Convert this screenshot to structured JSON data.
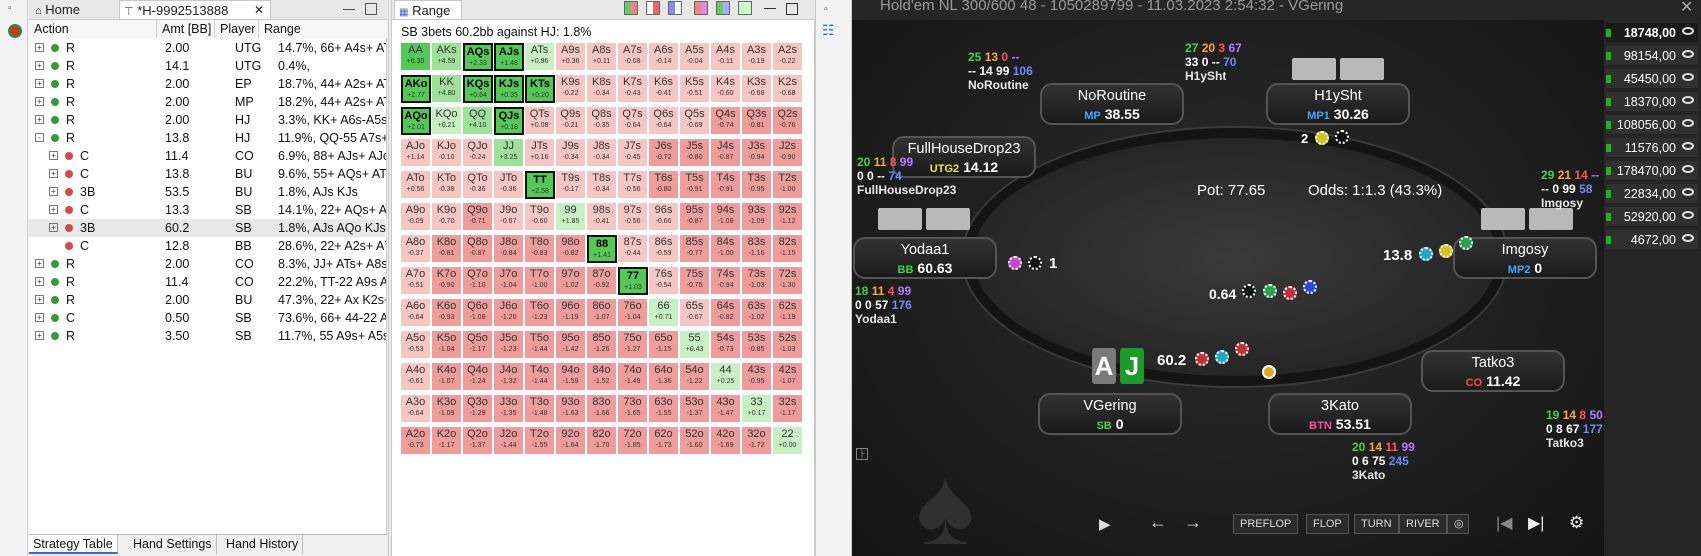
{
  "tabs": {
    "home": "Home",
    "hand": "*H-9992513888",
    "range": "Range"
  },
  "strategy": {
    "headers": [
      "Action",
      "Amt [BB]",
      "Player",
      "Range"
    ],
    "rows": [
      {
        "indent": 0,
        "exp": "+",
        "dot": "#3a9a3a",
        "action": "R",
        "amt": "2.00",
        "player": "UTG",
        "range": "14.7%, 66+ A4s+ ATo+"
      },
      {
        "indent": 0,
        "exp": "+",
        "dot": "#3a9a3a",
        "action": "R",
        "amt": "14.1",
        "player": "UTG",
        "range": "0.4%,"
      },
      {
        "indent": 0,
        "exp": "+",
        "dot": "#3a9a3a",
        "action": "R",
        "amt": "2.00",
        "player": "EP",
        "range": "18.7%, 44+ A2s+ ATo+"
      },
      {
        "indent": 0,
        "exp": "+",
        "dot": "#3a9a3a",
        "action": "R",
        "amt": "2.00",
        "player": "MP",
        "range": "18.2%, 44+ A2s+ ATo+"
      },
      {
        "indent": 0,
        "exp": "+",
        "dot": "#3a9a3a",
        "action": "R",
        "amt": "2.00",
        "player": "HJ",
        "range": "3.3%, KK+ A6s-A5s QT"
      },
      {
        "indent": 0,
        "exp": "-",
        "dot": "#3a9a3a",
        "action": "R",
        "amt": "13.8",
        "player": "HJ",
        "range": "11.9%, QQ-55 A7s+ A5"
      },
      {
        "indent": 1,
        "exp": "+",
        "dot": "#d24a4a",
        "action": "C",
        "amt": "11.4",
        "player": "CO",
        "range": "6.9%, 88+ AJs+ AJo+"
      },
      {
        "indent": 1,
        "exp": "+",
        "dot": "#d24a4a",
        "action": "C",
        "amt": "13.8",
        "player": "BU",
        "range": "9.6%, 55+ AQs+ ATs-A"
      },
      {
        "indent": 1,
        "exp": "+",
        "dot": "#d24a4a",
        "action": "3B",
        "amt": "53.5",
        "player": "BU",
        "range": "1.8%, AJs KJs"
      },
      {
        "indent": 1,
        "exp": "+",
        "dot": "#d24a4a",
        "action": "C",
        "amt": "13.3",
        "player": "SB",
        "range": "14.1%, 22+ AQs+ ATs-"
      },
      {
        "indent": 1,
        "exp": "+",
        "dot": "#d24a4a",
        "action": "3B",
        "amt": "60.2",
        "player": "SB",
        "range": "1.8%, AJs AQo KJs-KT"
      },
      {
        "indent": 1,
        "exp": "",
        "dot": "#d24a4a",
        "action": "C",
        "amt": "12.8",
        "player": "BB",
        "range": "28.6%, 22+ A2s+ A7o+"
      },
      {
        "indent": 0,
        "exp": "+",
        "dot": "#3a9a3a",
        "action": "R",
        "amt": "2.00",
        "player": "CO",
        "range": "8.3%, JJ+ ATs+ A8s A4"
      },
      {
        "indent": 0,
        "exp": "+",
        "dot": "#3a9a3a",
        "action": "R",
        "amt": "11.4",
        "player": "CO",
        "range": "22.2%, TT-22 A9s A7s-"
      },
      {
        "indent": 0,
        "exp": "+",
        "dot": "#3a9a3a",
        "action": "R",
        "amt": "2.00",
        "player": "BU",
        "range": "47.3%, 22+ Ax K2s+ K"
      },
      {
        "indent": 0,
        "exp": "+",
        "dot": "#3a9a3a",
        "action": "C",
        "amt": "0.50",
        "player": "SB",
        "range": "73.6%, 66+ 44-22 A8s-"
      },
      {
        "indent": 0,
        "exp": "+",
        "dot": "#3a9a3a",
        "action": "R",
        "amt": "3.50",
        "player": "SB",
        "range": "11.7%, 55 A9s+ A5s KT"
      }
    ],
    "bottom_tabs": [
      "Strategy Table",
      "Hand Settings",
      "Hand History"
    ]
  },
  "range": {
    "title": "SB 3bets 60.2bb against HJ: 1.8%",
    "grid": [
      [
        [
          "AA",
          "+6.30",
          "g"
        ],
        [
          "AKs",
          "+4.59",
          "lg"
        ],
        [
          "AQs",
          "+2.33",
          "gb"
        ],
        [
          "AJs",
          "+1.48",
          "gb"
        ],
        [
          "ATs",
          "+0.96",
          "lg"
        ],
        [
          "A9s",
          "+0.36",
          "lr"
        ],
        [
          "A8s",
          "+0.11",
          "lr"
        ],
        [
          "A7s",
          "-0.08",
          "lr"
        ],
        [
          "A6s",
          "-0.14",
          "lr"
        ],
        [
          "A5s",
          "-0.04",
          "lr"
        ],
        [
          "A4s",
          "-0.11",
          "lr"
        ],
        [
          "A3s",
          "-0.19",
          "lr"
        ],
        [
          "A2s",
          "-0.22",
          "lr"
        ]
      ],
      [
        [
          "AKo",
          "+2.77",
          "gb"
        ],
        [
          "KK",
          "+4.80",
          "lg"
        ],
        [
          "KQs",
          "+0.64",
          "gb"
        ],
        [
          "KJs",
          "+0.35",
          "gb"
        ],
        [
          "KTs",
          "+0.20",
          "gb"
        ],
        [
          "K9s",
          "-0.22",
          "lr"
        ],
        [
          "K8s",
          "-0.34",
          "lr"
        ],
        [
          "K7s",
          "-0.43",
          "lr"
        ],
        [
          "K6s",
          "-0.41",
          "lr"
        ],
        [
          "K5s",
          "-0.51",
          "lr"
        ],
        [
          "K4s",
          "-0.60",
          "lr"
        ],
        [
          "K3s",
          "-0.68",
          "lr"
        ],
        [
          "K2s",
          "-0.68",
          "lr"
        ]
      ],
      [
        [
          "AQo",
          "+2.01",
          "gb"
        ],
        [
          "KQo",
          "+0.21",
          "lg"
        ],
        [
          "QQ",
          "+4.10",
          "lg"
        ],
        [
          "QJs",
          "+0.18",
          "gb"
        ],
        [
          "QTs",
          "+0.08",
          "lr"
        ],
        [
          "Q9s",
          "-0.21",
          "lr"
        ],
        [
          "Q8s",
          "-0.35",
          "lr"
        ],
        [
          "Q7s",
          "-0.64",
          "lr"
        ],
        [
          "Q6s",
          "-0.64",
          "lr"
        ],
        [
          "Q5s",
          "-0.69",
          "lr"
        ],
        [
          "Q4s",
          "-0.74",
          "lr"
        ],
        [
          "Q3s",
          "-0.81",
          "lr"
        ],
        [
          "Q2s",
          "-0.76",
          "lr"
        ]
      ],
      [
        [
          "AJo",
          "+1.14",
          "lr"
        ],
        [
          "KJo",
          "-0.10",
          "lr"
        ],
        [
          "QJo",
          "-0.24",
          "lr"
        ],
        [
          "JJ",
          "+3.25",
          "lg"
        ],
        [
          "JTs",
          "+0.16",
          "lr"
        ],
        [
          "J9s",
          "-0.34",
          "lr"
        ],
        [
          "J8s",
          "-0.34",
          "lr"
        ],
        [
          "J7s",
          "-0.45",
          "lr"
        ],
        [
          "J6s",
          "-0.72",
          "lr"
        ],
        [
          "J5s",
          "-0.80",
          "lr"
        ],
        [
          "J4s",
          "-0.87",
          "lr"
        ],
        [
          "J3s",
          "-0.94",
          "lr"
        ],
        [
          "J2s",
          "-0.90",
          "lr"
        ]
      ],
      [
        [
          "ATo",
          "+0.56",
          "lr"
        ],
        [
          "KTo",
          "-0.38",
          "lr"
        ],
        [
          "QTo",
          "-0.36",
          "lr"
        ],
        [
          "JTo",
          "-0.36",
          "lr"
        ],
        [
          "TT",
          "+2.58",
          "gb"
        ],
        [
          "T9s",
          "-0.17",
          "lr"
        ],
        [
          "T8s",
          "-0.34",
          "lr"
        ],
        [
          "T7s",
          "-0.56",
          "lr"
        ],
        [
          "T6s",
          "-0.80",
          "lr"
        ],
        [
          "T5s",
          "-0.91",
          "lr"
        ],
        [
          "T4s",
          "-0.91",
          "lr"
        ],
        [
          "T3s",
          "-0.95",
          "lr"
        ],
        [
          "T2s",
          "-1.00",
          "lr"
        ]
      ],
      [
        [
          "A9o",
          "-0.09",
          "lr"
        ],
        [
          "K9o",
          "-0.70",
          "lr"
        ],
        [
          "Q9o",
          "-0.71",
          "lr"
        ],
        [
          "J9o",
          "-0.67",
          "lr"
        ],
        [
          "T9o",
          "-0.60",
          "lr"
        ],
        [
          "99",
          "+1.85",
          "lg"
        ],
        [
          "98s",
          "-0.41",
          "lr"
        ],
        [
          "97s",
          "-0.56",
          "lr"
        ],
        [
          "96s",
          "-0.66",
          "lr"
        ],
        [
          "95s",
          "-0.87",
          "lr"
        ],
        [
          "94s",
          "-1.08",
          "lr"
        ],
        [
          "93s",
          "-1.09",
          "lr"
        ],
        [
          "92s",
          "-1.12",
          "lr"
        ]
      ],
      [
        [
          "A8o",
          "-0.37",
          "lr"
        ],
        [
          "K8o",
          "-0.81",
          "lr"
        ],
        [
          "Q8o",
          "-0.87",
          "lr"
        ],
        [
          "J8o",
          "-0.84",
          "lr"
        ],
        [
          "T8o",
          "-0.83",
          "lr"
        ],
        [
          "98o",
          "-0.82",
          "lr"
        ],
        [
          "88",
          "+1.41",
          "gb"
        ],
        [
          "87s",
          "-0.44",
          "lr"
        ],
        [
          "86s",
          "-0.59",
          "lr"
        ],
        [
          "85s",
          "-0.77",
          "lr"
        ],
        [
          "84s",
          "-1.00",
          "lr"
        ],
        [
          "83s",
          "-1.16",
          "lr"
        ],
        [
          "82s",
          "-1.15",
          "lr"
        ]
      ],
      [
        [
          "A7o",
          "-0.51",
          "lr"
        ],
        [
          "K7o",
          "-0.90",
          "lr"
        ],
        [
          "Q7o",
          "-1.10",
          "lr"
        ],
        [
          "J7o",
          "-1.04",
          "lr"
        ],
        [
          "T7o",
          "-1.00",
          "lr"
        ],
        [
          "97o",
          "-1.02",
          "lr"
        ],
        [
          "87o",
          "-0.92",
          "lr"
        ],
        [
          "77",
          "+1.03",
          "gb"
        ],
        [
          "76s",
          "-0.54",
          "lr"
        ],
        [
          "75s",
          "-0.75",
          "lr"
        ],
        [
          "74s",
          "-0.94",
          "lr"
        ],
        [
          "73s",
          "-1.03",
          "lr"
        ],
        [
          "72s",
          "-1.30",
          "lr"
        ]
      ],
      [
        [
          "A6o",
          "-0.64",
          "lr"
        ],
        [
          "K6o",
          "-0.93",
          "lr"
        ],
        [
          "Q6o",
          "-1.08",
          "lr"
        ],
        [
          "J6o",
          "-1.20",
          "lr"
        ],
        [
          "T6o",
          "-1.23",
          "lr"
        ],
        [
          "96o",
          "-1.19",
          "lr"
        ],
        [
          "86o",
          "-1.07",
          "lr"
        ],
        [
          "76o",
          "-1.04",
          "lr"
        ],
        [
          "66",
          "+0.71",
          "lg"
        ],
        [
          "65s",
          "-0.67",
          "lr"
        ],
        [
          "64s",
          "-0.82",
          "lr"
        ],
        [
          "63s",
          "-1.02",
          "lr"
        ],
        [
          "62s",
          "-1.19",
          "lr"
        ]
      ],
      [
        [
          "A5o",
          "-0.53",
          "lr"
        ],
        [
          "K5o",
          "-1.04",
          "lr"
        ],
        [
          "Q5o",
          "-1.17",
          "lr"
        ],
        [
          "J5o",
          "-1.23",
          "lr"
        ],
        [
          "T5o",
          "-1.44",
          "lr"
        ],
        [
          "95o",
          "-1.42",
          "lr"
        ],
        [
          "85o",
          "-1.26",
          "lr"
        ],
        [
          "75o",
          "-1.27",
          "lr"
        ],
        [
          "65o",
          "-1.15",
          "lr"
        ],
        [
          "55",
          "+0.43",
          "lg"
        ],
        [
          "54s",
          "-0.73",
          "lr"
        ],
        [
          "53s",
          "-0.85",
          "lr"
        ],
        [
          "52s",
          "-1.03",
          "lr"
        ]
      ],
      [
        [
          "A4o",
          "-0.61",
          "lr"
        ],
        [
          "K4o",
          "-1.07",
          "lr"
        ],
        [
          "Q4o",
          "-1.24",
          "lr"
        ],
        [
          "J4o",
          "-1.32",
          "lr"
        ],
        [
          "T4o",
          "-1.44",
          "lr"
        ],
        [
          "94o",
          "-1.59",
          "lr"
        ],
        [
          "84o",
          "-1.52",
          "lr"
        ],
        [
          "74o",
          "-1.49",
          "lr"
        ],
        [
          "64o",
          "-1.36",
          "lr"
        ],
        [
          "54o",
          "-1.22",
          "lr"
        ],
        [
          "44",
          "+0.25",
          "lg"
        ],
        [
          "43s",
          "-0.95",
          "lr"
        ],
        [
          "42s",
          "-1.07",
          "lr"
        ]
      ],
      [
        [
          "A3o",
          "-0.64",
          "lr"
        ],
        [
          "K3o",
          "-1.09",
          "lr"
        ],
        [
          "Q3o",
          "-1.29",
          "lr"
        ],
        [
          "J3o",
          "-1.35",
          "lr"
        ],
        [
          "T3o",
          "-1.48",
          "lr"
        ],
        [
          "93o",
          "-1.63",
          "lr"
        ],
        [
          "83o",
          "-1.66",
          "lr"
        ],
        [
          "73o",
          "-1.65",
          "lr"
        ],
        [
          "63o",
          "-1.55",
          "lr"
        ],
        [
          "53o",
          "-1.37",
          "lr"
        ],
        [
          "43o",
          "-1.47",
          "lr"
        ],
        [
          "33",
          "+0.17",
          "lg"
        ],
        [
          "32s",
          "-1.17",
          "lr"
        ]
      ],
      [
        [
          "A2o",
          "-0.73",
          "lr"
        ],
        [
          "K2o",
          "-1.17",
          "lr"
        ],
        [
          "Q2o",
          "-1.37",
          "lr"
        ],
        [
          "J2o",
          "-1.44",
          "lr"
        ],
        [
          "T2o",
          "-1.55",
          "lr"
        ],
        [
          "92o",
          "-1.64",
          "lr"
        ],
        [
          "82o",
          "-1.70",
          "lr"
        ],
        [
          "72o",
          "-1.85",
          "lr"
        ],
        [
          "62o",
          "-1.73",
          "lr"
        ],
        [
          "52o",
          "-1.60",
          "lr"
        ],
        [
          "42o",
          "-1.69",
          "lr"
        ],
        [
          "32o",
          "-1.72",
          "lr"
        ],
        [
          "22",
          "+0.00",
          "lg"
        ]
      ]
    ]
  },
  "colors": {
    "green": "#56c85a",
    "lightgreen": "#c9f0c4",
    "lightred": "#f6c6c4",
    "red": "#ee9c9c"
  },
  "game": {
    "title": "Hold'em NL 300/600 48 - 1050289799 - 11.03.2023 2:54:32 - VGering",
    "pot": "Pot:  77.65",
    "odds": "Odds:  1:1.3 (43.3%)",
    "players": [
      {
        "id": "noroutine",
        "name": "NoRoutine",
        "pos": "MP",
        "posColor": "#3da8ff",
        "stack": "38.55"
      },
      {
        "id": "h1ysht",
        "name": "H1ySht",
        "pos": "MP1",
        "posColor": "#3da8ff",
        "stack": "30.26"
      },
      {
        "id": "fullhouse",
        "name": "FullHouseDrop23",
        "pos": "UTG2",
        "posColor": "#f2e24b",
        "stack": "14.12"
      },
      {
        "id": "yodaa1",
        "name": "Yodaa1",
        "pos": "BB",
        "posColor": "#4ad04a",
        "stack": "60.63"
      },
      {
        "id": "imgosy",
        "name": "Imgosy",
        "pos": "MP2",
        "posColor": "#3da8ff",
        "stack": "0"
      },
      {
        "id": "tatko3",
        "name": "Tatko3",
        "pos": "CO",
        "posColor": "#ff4d4d",
        "stack": "11.42"
      },
      {
        "id": "3kato",
        "name": "3Kato",
        "pos": "BTN",
        "posColor": "#ff4da6",
        "stack": "53.51"
      },
      {
        "id": "vgering",
        "name": "VGering",
        "pos": "SB",
        "posColor": "#4ad04a",
        "stack": "0"
      }
    ],
    "stats": [
      {
        "id": "noroutine",
        "l1": [
          "25",
          "13",
          "0",
          "--"
        ],
        "l2": [
          "--",
          "14",
          "99",
          "106"
        ],
        "label": "NoRoutine"
      },
      {
        "id": "h1ysht",
        "l1": [
          "27",
          "20",
          "3",
          "67"
        ],
        "l2": [
          "33",
          "0",
          "--",
          "70"
        ],
        "label": "H1ySht"
      },
      {
        "id": "fullhouse",
        "l1": [
          "20",
          "11",
          "8",
          "99"
        ],
        "l2": [
          "0",
          "0",
          "--",
          "74"
        ],
        "label": "FullHouseDrop23"
      },
      {
        "id": "imgosy",
        "l1": [
          "29",
          "21",
          "14",
          "--"
        ],
        "l2": [
          "--",
          "0",
          "99",
          "58"
        ],
        "label": "Imgosy"
      },
      {
        "id": "yodaa1",
        "l1": [
          "18",
          "11",
          "4",
          "99"
        ],
        "l2": [
          "0",
          "0",
          "57",
          "176"
        ],
        "label": "Yodaa1"
      },
      {
        "id": "tatko3",
        "l1": [
          "19",
          "14",
          "8",
          "50"
        ],
        "l2": [
          "0",
          "8",
          "67",
          "177"
        ],
        "label": "Tatko3"
      },
      {
        "id": "3kato",
        "l1": [
          "20",
          "14",
          "11",
          "99"
        ],
        "l2": [
          "0",
          "6",
          "75",
          "245"
        ],
        "label": "3Kato"
      }
    ],
    "bets": {
      "h1ysht": "2",
      "yodaa1": "1",
      "imgosy": "13.8",
      "center": "0.64",
      "vgering": "60.2"
    },
    "hero_cards": [
      "A",
      "J"
    ],
    "sidebar_values": [
      "18748,00",
      "98154,00",
      "45450,00",
      "18370,00",
      "108056,00",
      "11576,00",
      "178470,00",
      "22834,00",
      "52920,00",
      "4672,00"
    ],
    "controls": [
      "PREFLOP",
      "FLOP",
      "TURN",
      "RIVER"
    ]
  }
}
